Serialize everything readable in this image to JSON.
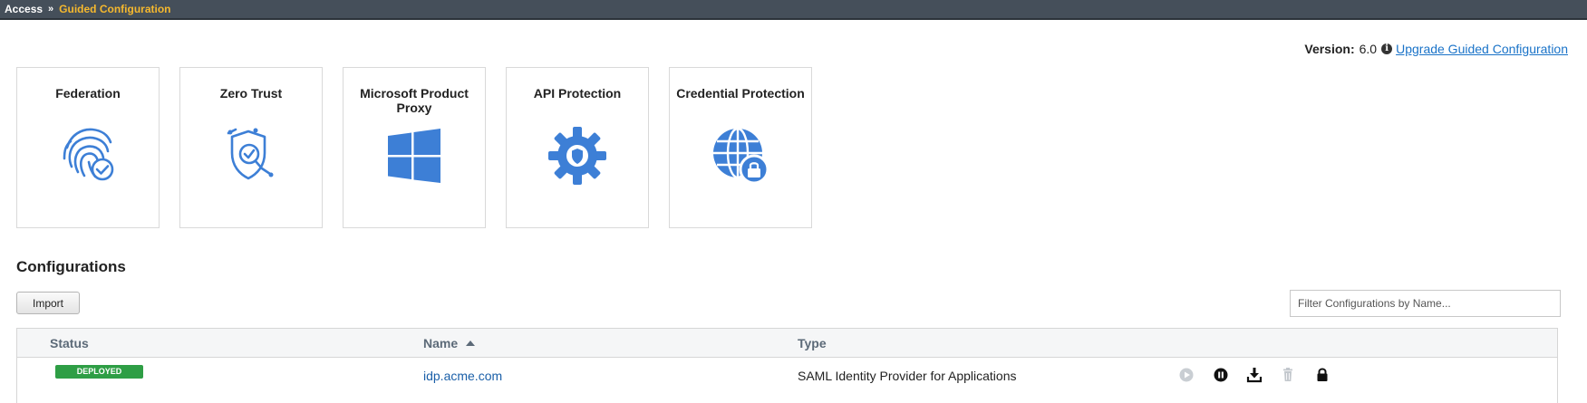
{
  "breadcrumb": {
    "root": "Access",
    "separator": "»",
    "current": "Guided Configuration"
  },
  "version": {
    "label": "Version:",
    "value": "6.0",
    "info_icon": "i",
    "upgrade_link": "Upgrade Guided Configuration"
  },
  "tiles": [
    {
      "title": "Federation",
      "icon": "fingerprint-check-icon"
    },
    {
      "title": "Zero Trust",
      "icon": "shield-check-icon"
    },
    {
      "title": "Microsoft Product Proxy",
      "icon": "windows-logo-icon"
    },
    {
      "title": "API Protection",
      "icon": "gear-shield-icon"
    },
    {
      "title": "Credential Protection",
      "icon": "globe-lock-icon"
    }
  ],
  "configurations": {
    "title": "Configurations",
    "import_label": "Import",
    "filter_placeholder": "Filter Configurations by Name...",
    "columns": {
      "status": "Status",
      "name": "Name",
      "type": "Type"
    },
    "sort": {
      "column": "name",
      "direction": "ascending"
    },
    "rows": [
      {
        "status": "DEPLOYED",
        "name": "idp.acme.com",
        "type": "SAML Identity Provider for Applications",
        "actions": [
          "play-icon",
          "pause-icon",
          "download-icon",
          "trash-icon",
          "lock-icon"
        ]
      }
    ]
  },
  "colors": {
    "accent": "#3d7fd6",
    "topbar": "#454f5a",
    "breadcrumb_current": "#f5b82e",
    "deployed": "#2e9e45",
    "link": "#1a73c8"
  }
}
